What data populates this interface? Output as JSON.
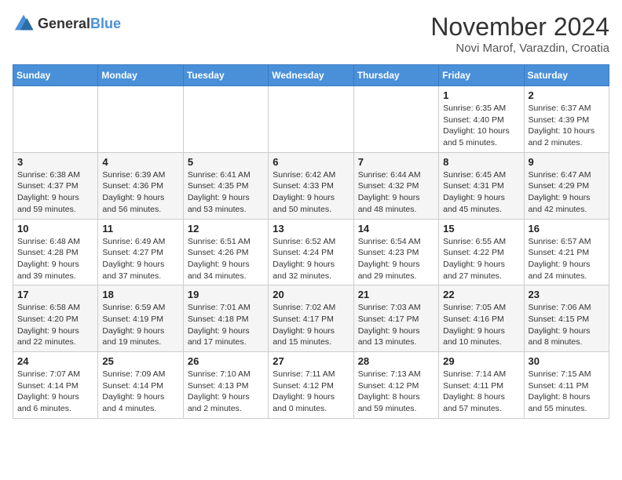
{
  "header": {
    "logo_general": "General",
    "logo_blue": "Blue",
    "month_title": "November 2024",
    "location": "Novi Marof, Varazdin, Croatia"
  },
  "weekdays": [
    "Sunday",
    "Monday",
    "Tuesday",
    "Wednesday",
    "Thursday",
    "Friday",
    "Saturday"
  ],
  "weeks": [
    [
      {
        "day": "",
        "info": ""
      },
      {
        "day": "",
        "info": ""
      },
      {
        "day": "",
        "info": ""
      },
      {
        "day": "",
        "info": ""
      },
      {
        "day": "",
        "info": ""
      },
      {
        "day": "1",
        "info": "Sunrise: 6:35 AM\nSunset: 4:40 PM\nDaylight: 10 hours and 5 minutes."
      },
      {
        "day": "2",
        "info": "Sunrise: 6:37 AM\nSunset: 4:39 PM\nDaylight: 10 hours and 2 minutes."
      }
    ],
    [
      {
        "day": "3",
        "info": "Sunrise: 6:38 AM\nSunset: 4:37 PM\nDaylight: 9 hours and 59 minutes."
      },
      {
        "day": "4",
        "info": "Sunrise: 6:39 AM\nSunset: 4:36 PM\nDaylight: 9 hours and 56 minutes."
      },
      {
        "day": "5",
        "info": "Sunrise: 6:41 AM\nSunset: 4:35 PM\nDaylight: 9 hours and 53 minutes."
      },
      {
        "day": "6",
        "info": "Sunrise: 6:42 AM\nSunset: 4:33 PM\nDaylight: 9 hours and 50 minutes."
      },
      {
        "day": "7",
        "info": "Sunrise: 6:44 AM\nSunset: 4:32 PM\nDaylight: 9 hours and 48 minutes."
      },
      {
        "day": "8",
        "info": "Sunrise: 6:45 AM\nSunset: 4:31 PM\nDaylight: 9 hours and 45 minutes."
      },
      {
        "day": "9",
        "info": "Sunrise: 6:47 AM\nSunset: 4:29 PM\nDaylight: 9 hours and 42 minutes."
      }
    ],
    [
      {
        "day": "10",
        "info": "Sunrise: 6:48 AM\nSunset: 4:28 PM\nDaylight: 9 hours and 39 minutes."
      },
      {
        "day": "11",
        "info": "Sunrise: 6:49 AM\nSunset: 4:27 PM\nDaylight: 9 hours and 37 minutes."
      },
      {
        "day": "12",
        "info": "Sunrise: 6:51 AM\nSunset: 4:26 PM\nDaylight: 9 hours and 34 minutes."
      },
      {
        "day": "13",
        "info": "Sunrise: 6:52 AM\nSunset: 4:24 PM\nDaylight: 9 hours and 32 minutes."
      },
      {
        "day": "14",
        "info": "Sunrise: 6:54 AM\nSunset: 4:23 PM\nDaylight: 9 hours and 29 minutes."
      },
      {
        "day": "15",
        "info": "Sunrise: 6:55 AM\nSunset: 4:22 PM\nDaylight: 9 hours and 27 minutes."
      },
      {
        "day": "16",
        "info": "Sunrise: 6:57 AM\nSunset: 4:21 PM\nDaylight: 9 hours and 24 minutes."
      }
    ],
    [
      {
        "day": "17",
        "info": "Sunrise: 6:58 AM\nSunset: 4:20 PM\nDaylight: 9 hours and 22 minutes."
      },
      {
        "day": "18",
        "info": "Sunrise: 6:59 AM\nSunset: 4:19 PM\nDaylight: 9 hours and 19 minutes."
      },
      {
        "day": "19",
        "info": "Sunrise: 7:01 AM\nSunset: 4:18 PM\nDaylight: 9 hours and 17 minutes."
      },
      {
        "day": "20",
        "info": "Sunrise: 7:02 AM\nSunset: 4:17 PM\nDaylight: 9 hours and 15 minutes."
      },
      {
        "day": "21",
        "info": "Sunrise: 7:03 AM\nSunset: 4:17 PM\nDaylight: 9 hours and 13 minutes."
      },
      {
        "day": "22",
        "info": "Sunrise: 7:05 AM\nSunset: 4:16 PM\nDaylight: 9 hours and 10 minutes."
      },
      {
        "day": "23",
        "info": "Sunrise: 7:06 AM\nSunset: 4:15 PM\nDaylight: 9 hours and 8 minutes."
      }
    ],
    [
      {
        "day": "24",
        "info": "Sunrise: 7:07 AM\nSunset: 4:14 PM\nDaylight: 9 hours and 6 minutes."
      },
      {
        "day": "25",
        "info": "Sunrise: 7:09 AM\nSunset: 4:14 PM\nDaylight: 9 hours and 4 minutes."
      },
      {
        "day": "26",
        "info": "Sunrise: 7:10 AM\nSunset: 4:13 PM\nDaylight: 9 hours and 2 minutes."
      },
      {
        "day": "27",
        "info": "Sunrise: 7:11 AM\nSunset: 4:12 PM\nDaylight: 9 hours and 0 minutes."
      },
      {
        "day": "28",
        "info": "Sunrise: 7:13 AM\nSunset: 4:12 PM\nDaylight: 8 hours and 59 minutes."
      },
      {
        "day": "29",
        "info": "Sunrise: 7:14 AM\nSunset: 4:11 PM\nDaylight: 8 hours and 57 minutes."
      },
      {
        "day": "30",
        "info": "Sunrise: 7:15 AM\nSunset: 4:11 PM\nDaylight: 8 hours and 55 minutes."
      }
    ]
  ]
}
